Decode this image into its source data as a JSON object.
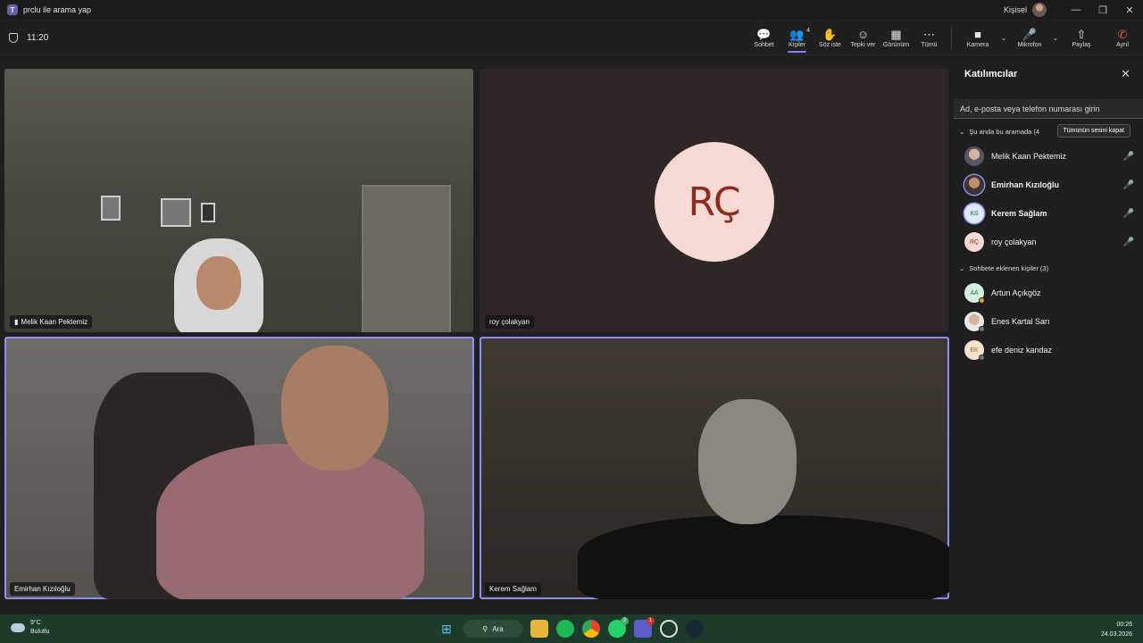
{
  "window": {
    "title": "prclu ile arama yap",
    "app_icon": "teams-icon",
    "profile_label": "Kişisel"
  },
  "call": {
    "timer": "11:20"
  },
  "toolbar": {
    "chat": "Sohbet",
    "people": "Kişiler",
    "people_count": "4",
    "raise": "Söz iste",
    "react": "Tepki ver",
    "view": "Görünüm",
    "more": "Tümü",
    "camera": "Kamera",
    "mic": "Mikrofon",
    "share": "Paylaş",
    "leave": "Ayrıl"
  },
  "tiles": [
    {
      "name": "Melik Kaan Pektemiz"
    },
    {
      "name": "roy çolakyan",
      "initials": "RÇ"
    },
    {
      "name": "Emirhan Kızıloğlu"
    },
    {
      "name": "Kerem Sağlam"
    }
  ],
  "panel": {
    "title": "Katılımcılar",
    "search_placeholder": "Ad, e-posta veya telefon numarası girin",
    "in_call_label": "Şu anda bu aramada (4",
    "mute_all": "Tümünün sesini kapat",
    "in_call": [
      {
        "name": "Melik Kaan Pektemiz",
        "initials": ""
      },
      {
        "name": "Emirhan Kızıloğlu",
        "initials": ""
      },
      {
        "name": "Kerem Sağlam",
        "initials": "KS"
      },
      {
        "name": "roy çolakyan",
        "initials": "RÇ"
      }
    ],
    "added_label": "Sohbete eklenen kişiler (3)",
    "added": [
      {
        "name": "Artun Açıkgöz",
        "initials": "AA"
      },
      {
        "name": "Enes Kartal Sarı",
        "initials": ""
      },
      {
        "name": "efe deniz kandaz",
        "initials": "EK"
      }
    ]
  },
  "taskbar": {
    "temp": "9°C",
    "weather": "Bulutlu",
    "search": "Ara",
    "whatsapp_badge": "2",
    "teams_badge": "1",
    "time": "00:26",
    "date": "24.03.2026"
  },
  "colors": {
    "accent": "#7f85f5",
    "leave": "#e0555b",
    "taskbar": "#1d3b2b"
  }
}
